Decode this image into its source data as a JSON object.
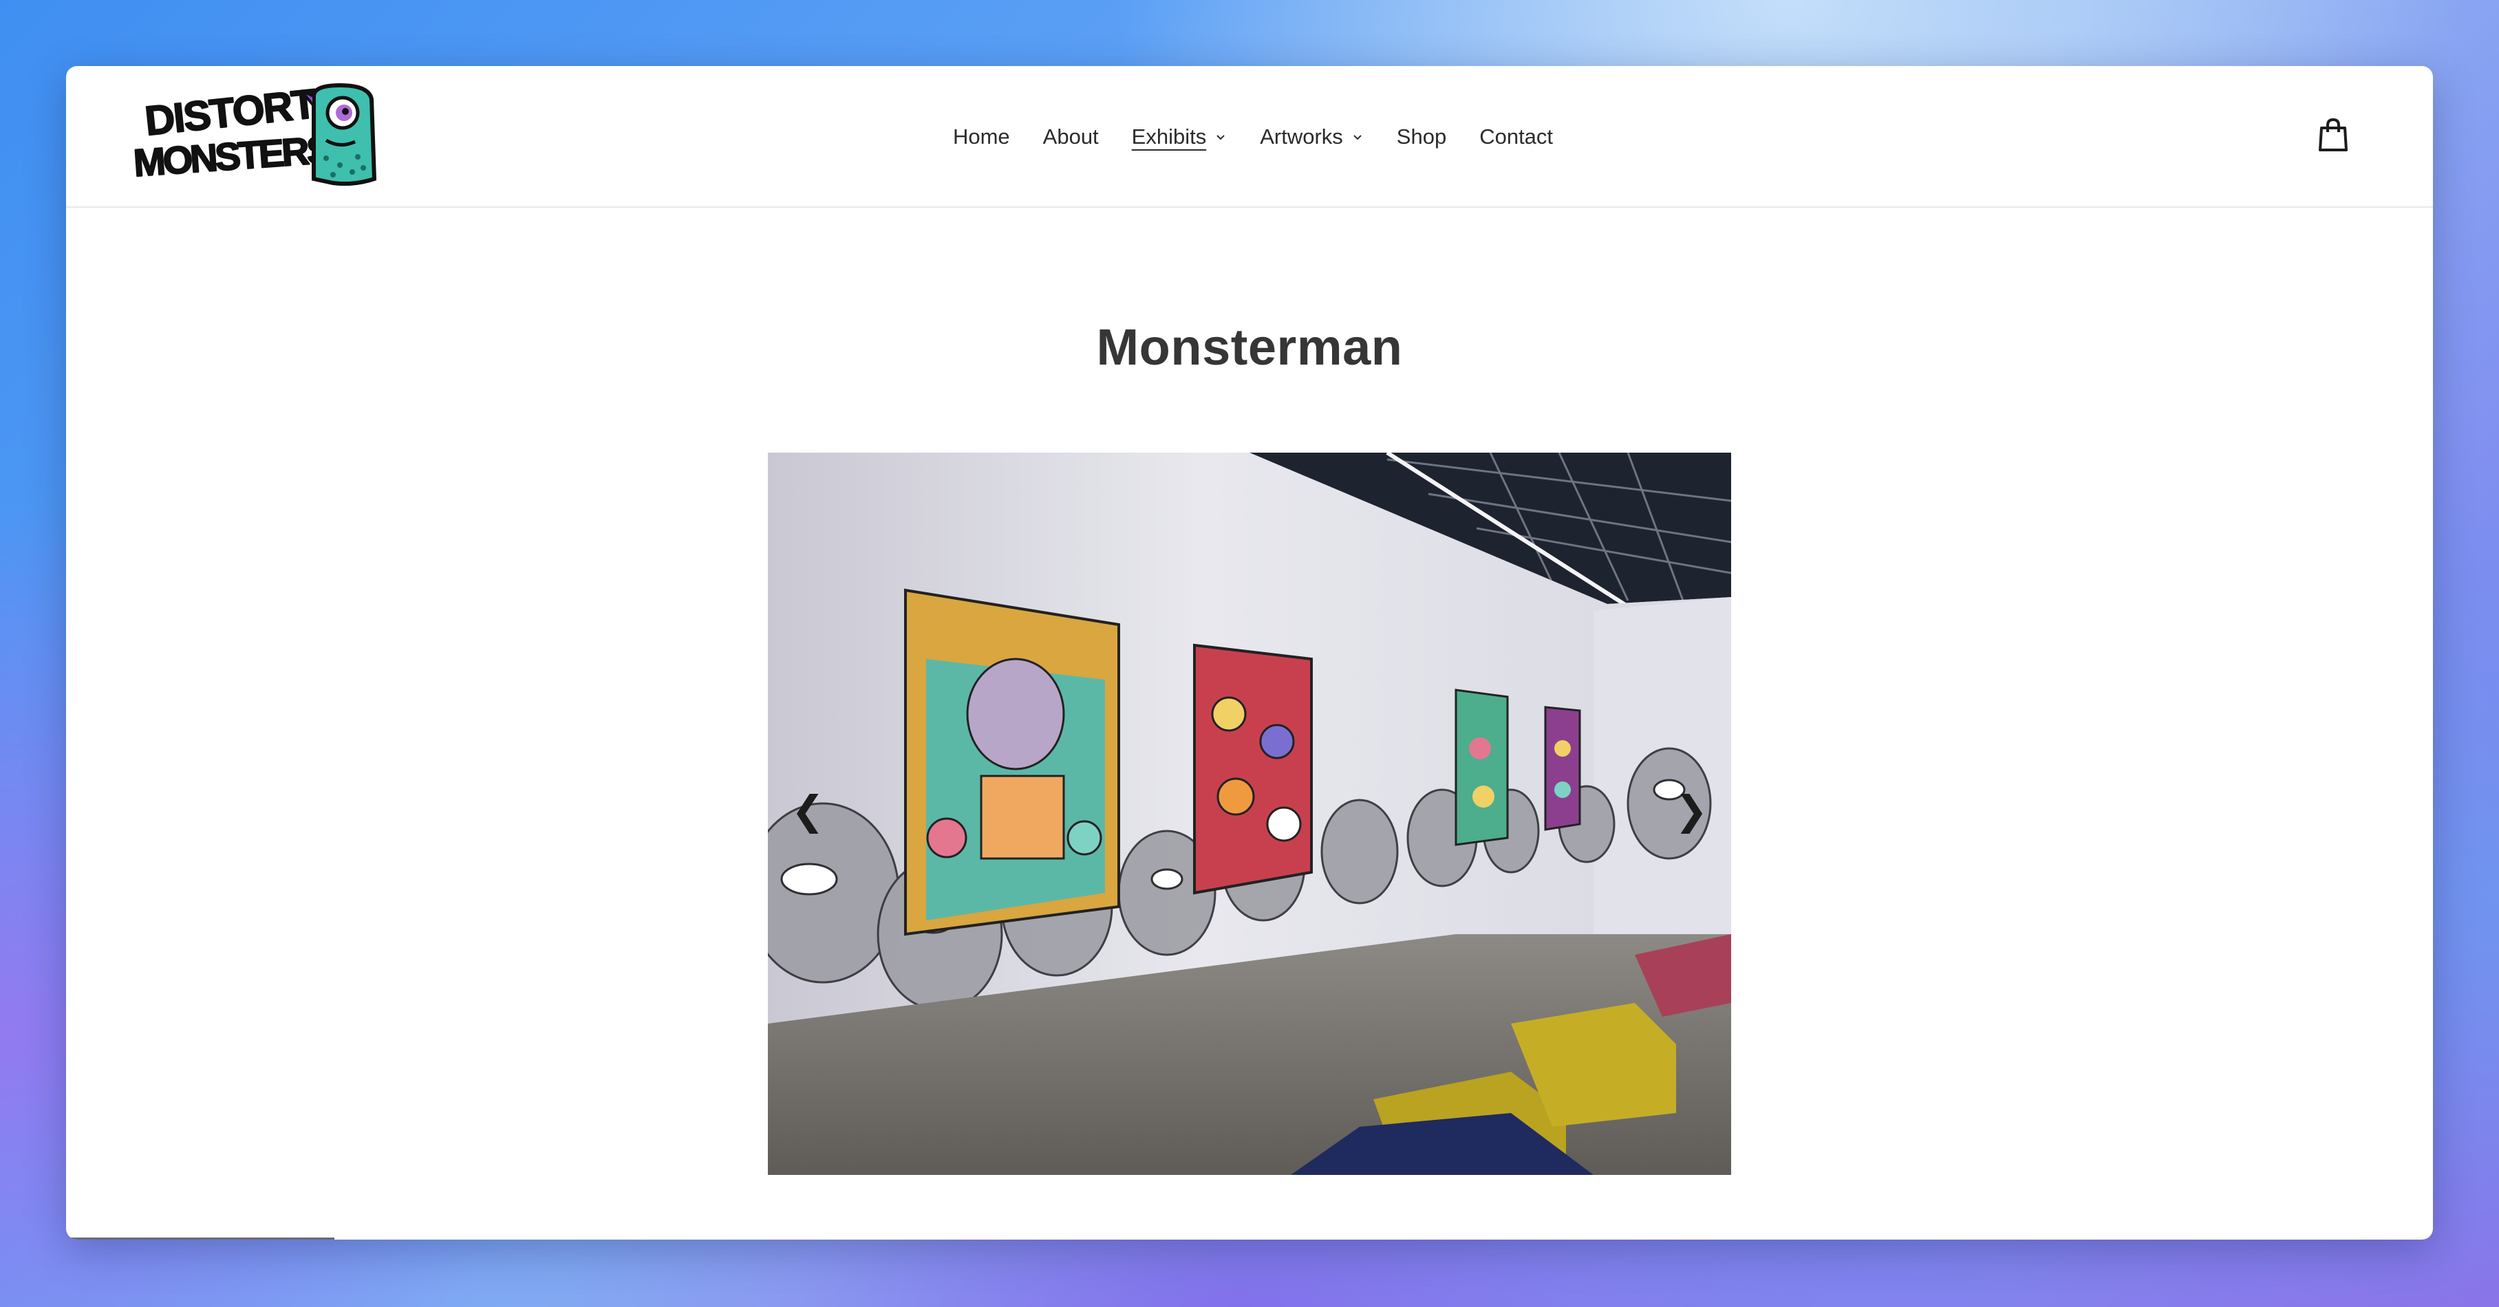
{
  "brand": {
    "logo_text_line1": "DISTORT",
    "logo_text_line2": "MONSTERS",
    "mascot_color": "#3fbfae"
  },
  "nav": {
    "items": [
      {
        "label": "Home",
        "has_dropdown": false,
        "active": false
      },
      {
        "label": "About",
        "has_dropdown": false,
        "active": false
      },
      {
        "label": "Exhibits",
        "has_dropdown": true,
        "active": true
      },
      {
        "label": "Artworks",
        "has_dropdown": true,
        "active": false
      },
      {
        "label": "Shop",
        "has_dropdown": false,
        "active": false
      },
      {
        "label": "Contact",
        "has_dropdown": false,
        "active": false
      }
    ],
    "cart_icon": "shopping-bag-icon"
  },
  "page": {
    "title": "Monsterman"
  },
  "slideshow": {
    "prev_glyph": "❮",
    "next_glyph": "❯",
    "image_subject": "gallery-wall-with-monster-paintings"
  }
}
